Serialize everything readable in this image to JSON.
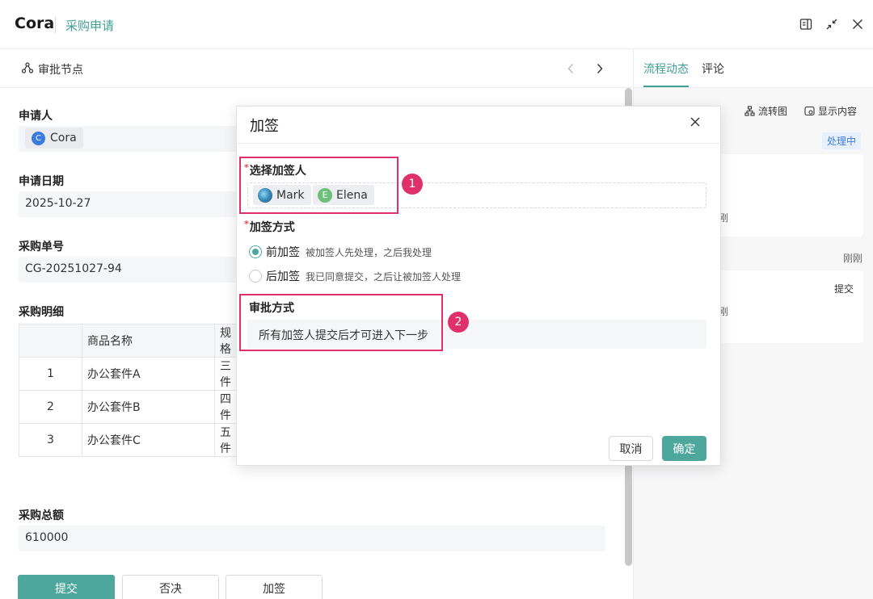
{
  "header": {
    "app_title": "Cora",
    "page_name": "采购申请",
    "icons": [
      "sidebar-panel-icon",
      "collapse-icon",
      "close-icon"
    ]
  },
  "node_bar": {
    "label": "审批节点"
  },
  "form": {
    "applicant_label": "申请人",
    "applicant_initial": "C",
    "applicant_name": "Cora",
    "date_label": "申请日期",
    "date_value": "2025-10-27",
    "order_label": "采购单号",
    "order_value": "CG-20251027-94",
    "detail_label": "采购明细",
    "table": {
      "headers": [
        "",
        "商品名称",
        "规格"
      ],
      "rows": [
        [
          "1",
          "办公套件A",
          "三件"
        ],
        [
          "2",
          "办公套件B",
          "四件"
        ],
        [
          "3",
          "办公套件C",
          "五件"
        ]
      ]
    },
    "total_label": "采购总额",
    "total_value": "610000"
  },
  "actions": {
    "submit": "提交",
    "reject": "否决",
    "add_signer": "加签"
  },
  "right_panel": {
    "tab_flow": "流程动态",
    "tab_comment": "评论",
    "flowchart_label": "流转图",
    "show_content_label": "显示内容",
    "status_badge": "处理中",
    "card1_text": "刚",
    "time_just_now": "刚刚",
    "card2_action": "提交",
    "card2_text": "刚"
  },
  "dialog": {
    "title": "加签",
    "signer_label": "选择加签人",
    "signers": [
      {
        "name": "Mark",
        "initial": ""
      },
      {
        "name": "Elena",
        "initial": "E"
      }
    ],
    "method_label": "加签方式",
    "options": [
      {
        "label": "前加签",
        "desc": "被加签人先处理，之后我处理",
        "selected": true
      },
      {
        "label": "后加签",
        "desc": "我已同意提交，之后让被加签人处理",
        "selected": false
      }
    ],
    "approval_label": "审批方式",
    "approval_value": "所有加签人提交后才可进入下一步",
    "cancel": "取消",
    "confirm": "确定"
  },
  "annotations": [
    "1",
    "2"
  ],
  "colors": {
    "accent": "#4ea79d",
    "accent_text": "#3f9f96",
    "highlight": "#e0306a",
    "badge_blue": "#3a7be0"
  }
}
